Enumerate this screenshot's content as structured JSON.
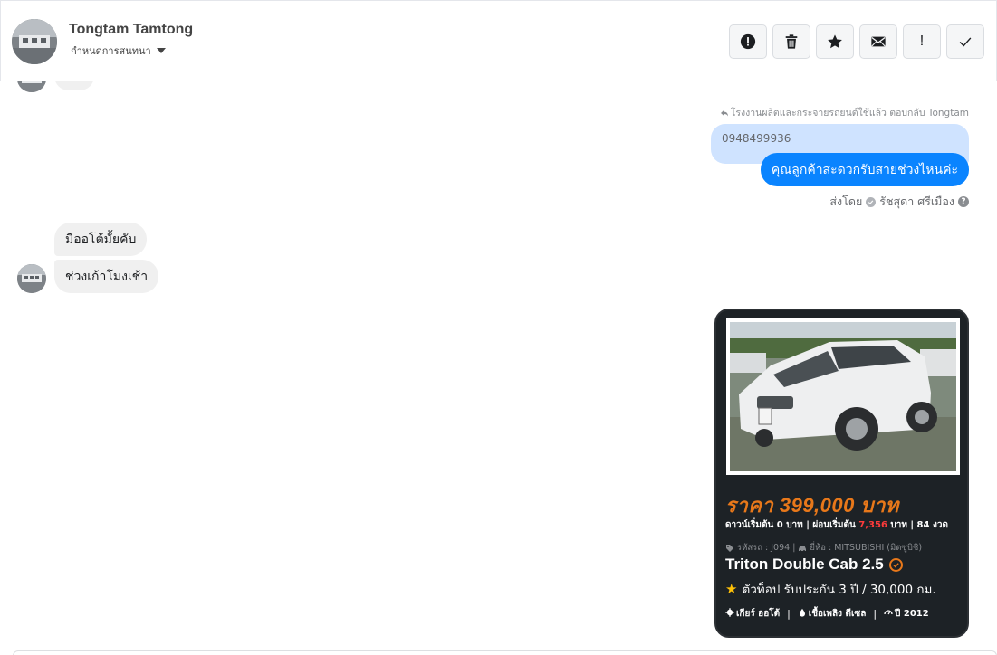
{
  "header": {
    "contact_name": "Tongtam Tamtong",
    "assign_label": "กำหนดการสนทนา",
    "toolbar": [
      {
        "name": "report-spam-button",
        "icon": "alert-circle-icon"
      },
      {
        "name": "delete-button",
        "icon": "trash-icon"
      },
      {
        "name": "star-button",
        "icon": "star-icon"
      },
      {
        "name": "mark-unread-button",
        "icon": "envelope-icon"
      },
      {
        "name": "follow-up-button",
        "icon": "exclamation-icon",
        "text": "!"
      },
      {
        "name": "mark-done-button",
        "icon": "checkmark-icon"
      }
    ]
  },
  "messages": {
    "reply_meta": "โรงงานผลิตและกระจายรถยนต์ใช้แล้ว ตอบกลับ Tongtam",
    "quoted_text": "0948499936",
    "outgoing_text": "คุณลูกค้าสะดวกรับสายช่วงไหนค่ะ",
    "sent_by_label": "ส่งโดย",
    "sent_by_name": "รัชสุดา ศรีเมือง",
    "incoming": [
      "มืออโต้มั้ยคับ",
      "ช่วงเก้าโมงเช้า"
    ]
  },
  "card": {
    "price": "ราคา 399,000 บาท",
    "installment_prefix": "ดาวน์เริ่มต้น 0 บาท | ผ่อนเริ่มต้น",
    "installment_amount": "7,356",
    "installment_suffix": "บาท | 84 งวด",
    "code_line": "รหัสรถ : J094 | ",
    "brand_line": "ยี่ห้อ : MITSUBISHI (มิตซูบิชิ)",
    "model": "Triton Double Cab 2.5",
    "top_feature": "ตัวท็อป รับประกัน 3 ปี / 30,000 กม.",
    "gear": "เกียร์ ออโต้",
    "fuel": "เชื้อเพลิง ดีเซล",
    "year": "ปี 2012"
  },
  "colors": {
    "outgoing_bubble": "#0a84ff",
    "quoted_bubble": "#cfe3ff",
    "incoming_bubble": "#f0f0f0",
    "card_bg": "#1d2226",
    "price_orange": "#e8781a",
    "installment_red": "#ff3b3b",
    "star_yellow": "#ffc107"
  }
}
